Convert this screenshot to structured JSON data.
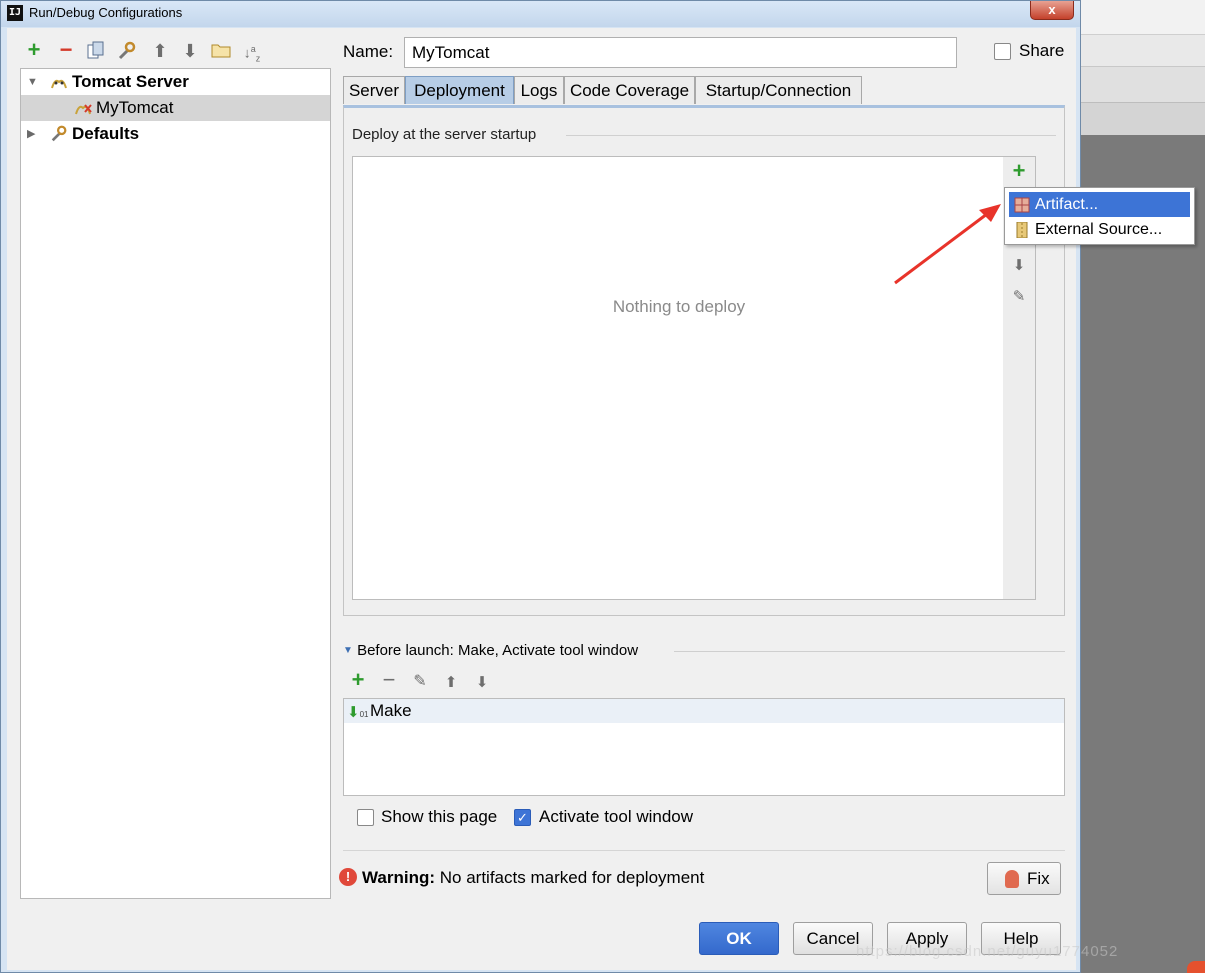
{
  "window": {
    "title": "Run/Debug Configurations",
    "icon_text": "IJ",
    "close_label": "x"
  },
  "toolbar": {
    "items": [
      {
        "name": "add-icon",
        "glyph": "+"
      },
      {
        "name": "remove-icon",
        "glyph": "−"
      },
      {
        "name": "copy-icon",
        "glyph": "⧉"
      },
      {
        "name": "wrench-icon",
        "glyph": "✎"
      },
      {
        "name": "move-up-icon",
        "glyph": "⬆"
      },
      {
        "name": "move-down-icon",
        "glyph": "⬇"
      },
      {
        "name": "folder-icon",
        "glyph": "▭"
      },
      {
        "name": "sort-icon",
        "glyph": "↓a"
      }
    ]
  },
  "tree": {
    "group_label": "Tomcat Server",
    "child_label": "MyTomcat",
    "defaults_label": "Defaults"
  },
  "name_field": {
    "label": "Name:",
    "value": "MyTomcat"
  },
  "share": {
    "label": "Share",
    "checked": false
  },
  "tabs": [
    "Server",
    "Deployment",
    "Logs",
    "Code Coverage",
    "Startup/Connection"
  ],
  "active_tab": "Deployment",
  "deployment": {
    "section_title": "Deploy at the server startup",
    "empty_text": "Nothing to deploy"
  },
  "add_popup": {
    "items": [
      "Artifact...",
      "External Source..."
    ],
    "highlighted": "Artifact..."
  },
  "before_launch": {
    "label": "Before launch: Make, Activate tool window",
    "items": [
      "Make"
    ]
  },
  "options": {
    "show_page_label": "Show this page",
    "show_page_checked": false,
    "activate_label": "Activate tool window",
    "activate_checked": true
  },
  "warning": {
    "bold": "Warning:",
    "text": "No artifacts marked for deployment",
    "fix_label": "Fix"
  },
  "buttons": {
    "ok": "OK",
    "cancel": "Cancel",
    "apply": "Apply",
    "help": "Help"
  },
  "watermark": "https://blog.csdn.net/guyu1774052",
  "colors": {
    "accent": "#3d74d6",
    "add_green": "#2e9b2e",
    "remove_red": "#d43a2a",
    "arrow_red": "#e8332a"
  }
}
